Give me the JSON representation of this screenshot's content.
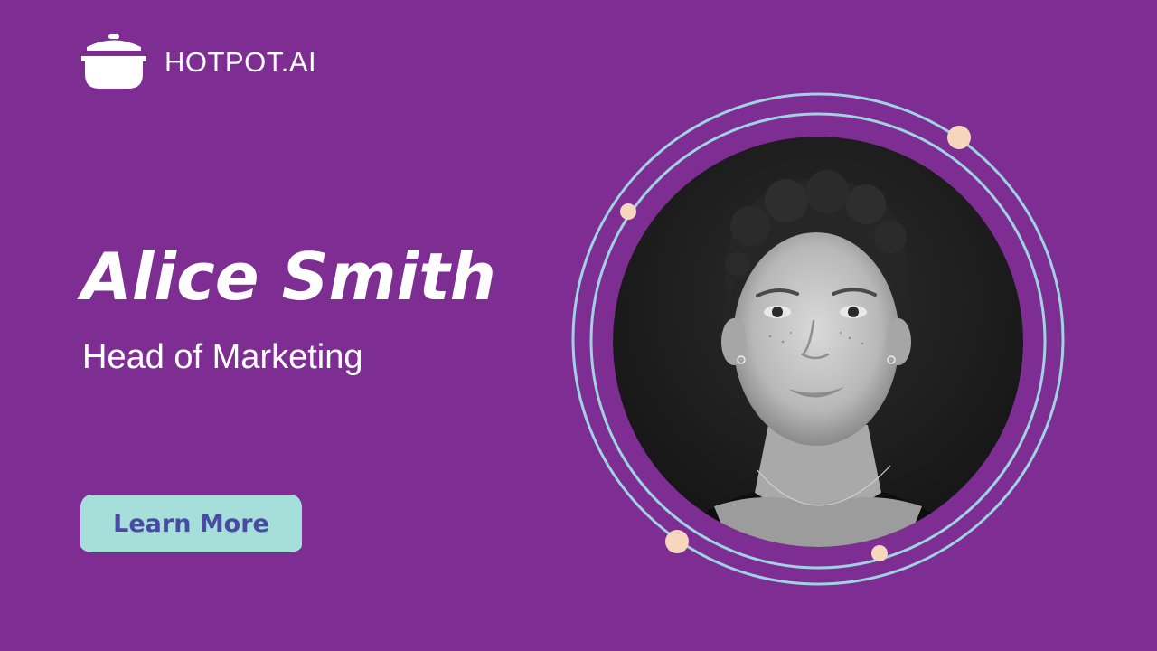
{
  "brand": {
    "name": "HOTPOT.AI",
    "icon": "cooking-pot-icon"
  },
  "profile": {
    "name": "Alice Smith",
    "title": "Head of Marketing"
  },
  "cta": {
    "label": "Learn More"
  },
  "colors": {
    "background": "#7E2D93",
    "ring": "#9FD3E2",
    "dot": "#F7D6BE",
    "button_bg": "#A6DFDA",
    "button_text": "#4B4AA3",
    "text": "#FFFFFF",
    "photo_bg": "#1D1D1D"
  }
}
